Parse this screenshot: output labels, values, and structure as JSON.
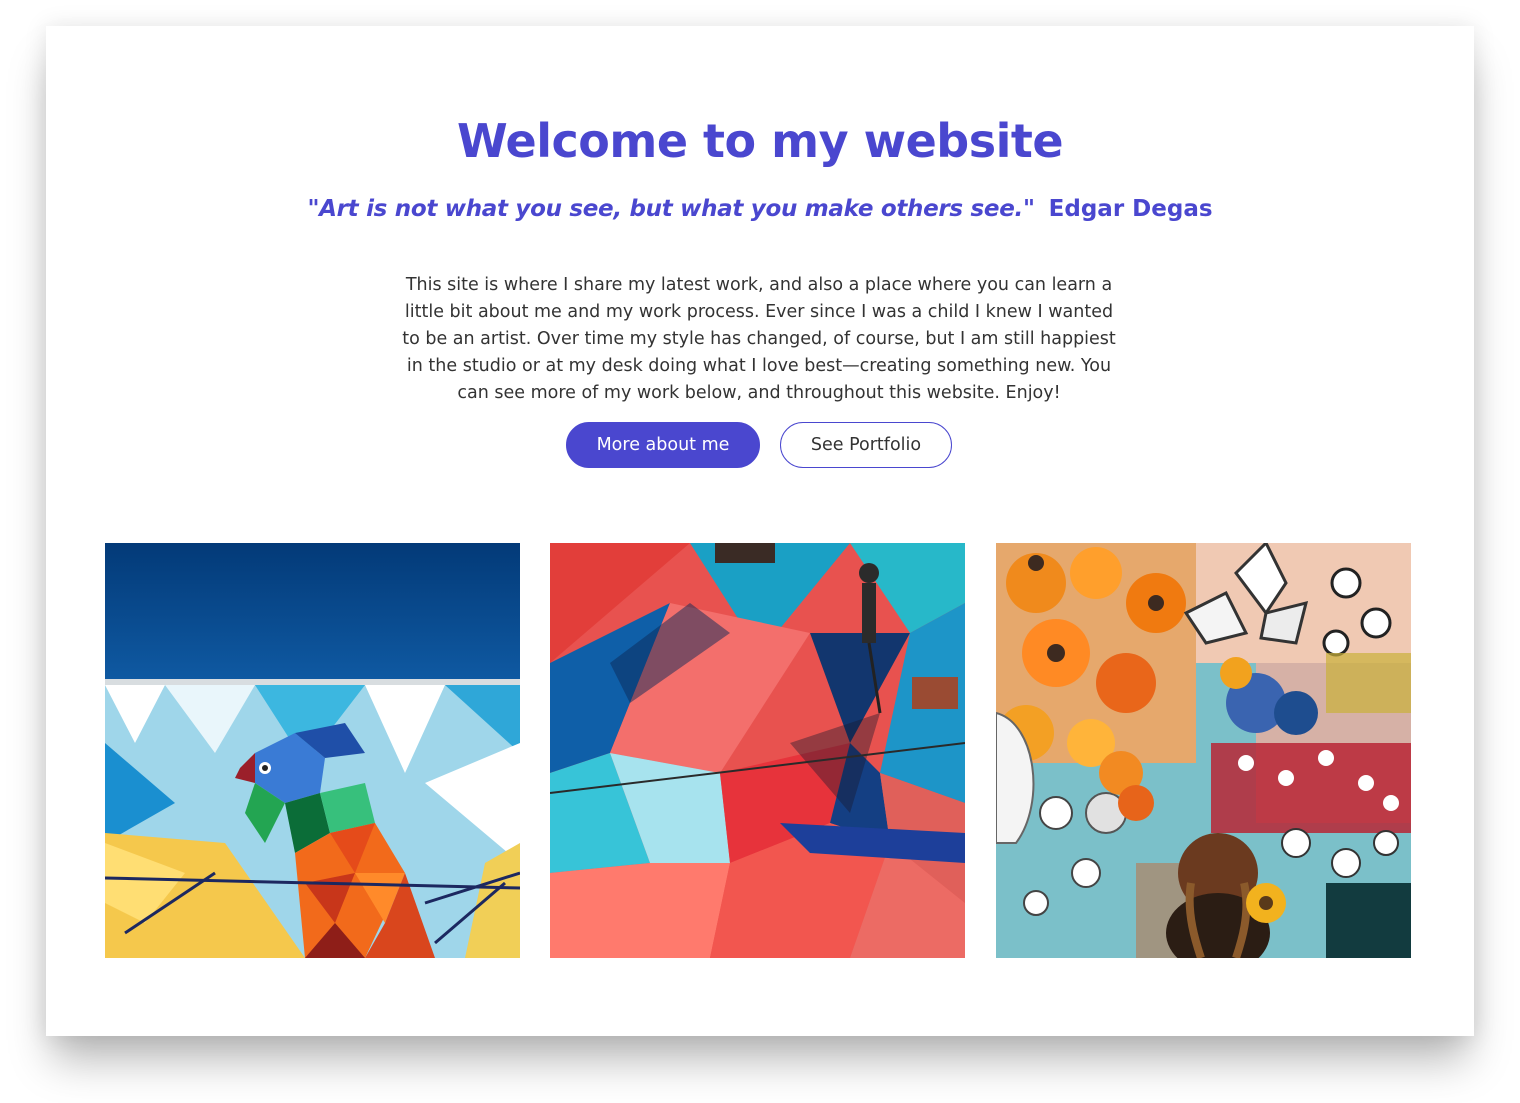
{
  "header": {
    "title": "Welcome to my website",
    "quote": "\"Art is not what you see, but what you make others see.\"",
    "quote_author": "Edgar Degas"
  },
  "intro": {
    "text": "This site is where I share my latest work, and also a place where you can learn a little bit about me and my work process. Ever since I was a child I knew I wanted to be an artist. Over time my style has changed, of course, but I am still happiest in the studio or at my desk doing what I love best—creating something new. You can see more of my work below, and throughout this website. Enjoy!"
  },
  "buttons": {
    "primary_label": "More about me",
    "secondary_label": "See Portfolio"
  },
  "colors": {
    "accent": "#4a47cf",
    "text": "#333333",
    "background": "#ffffff"
  },
  "gallery": {
    "images": [
      {
        "alt": "mural-bird-artwork"
      },
      {
        "alt": "mural-abstract-artwork"
      },
      {
        "alt": "mural-flowers-artwork"
      }
    ]
  }
}
